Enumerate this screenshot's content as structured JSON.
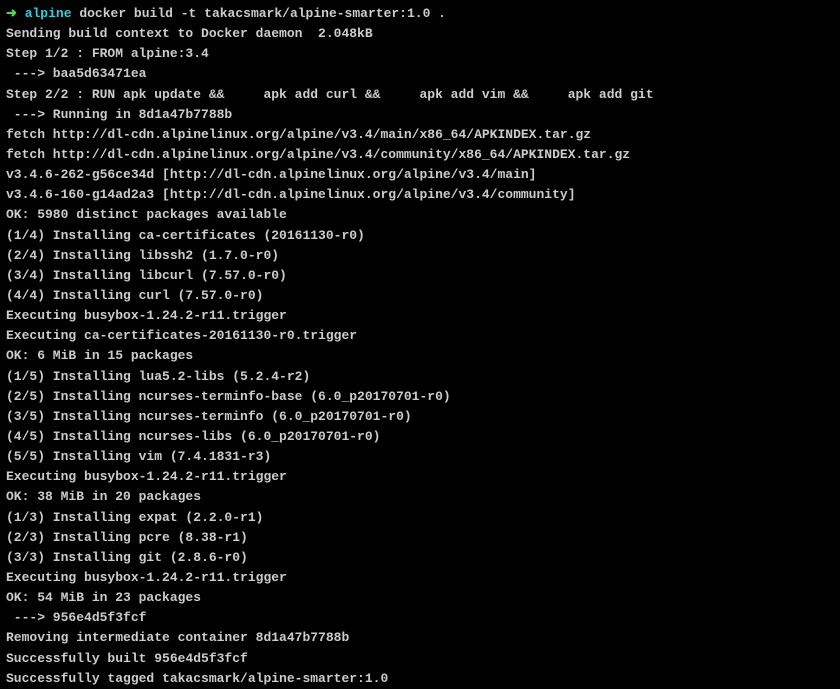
{
  "prompt": {
    "arrow": "➜ ",
    "dir": "alpine",
    "command": " docker build -t takacsmark/alpine-smarter:1.0 ."
  },
  "lines": [
    "Sending build context to Docker daemon  2.048kB",
    "Step 1/2 : FROM alpine:3.4",
    " ---> baa5d63471ea",
    "Step 2/2 : RUN apk update &&     apk add curl &&     apk add vim &&     apk add git",
    " ---> Running in 8d1a47b7788b",
    "fetch http://dl-cdn.alpinelinux.org/alpine/v3.4/main/x86_64/APKINDEX.tar.gz",
    "fetch http://dl-cdn.alpinelinux.org/alpine/v3.4/community/x86_64/APKINDEX.tar.gz",
    "v3.4.6-262-g56ce34d [http://dl-cdn.alpinelinux.org/alpine/v3.4/main]",
    "v3.4.6-160-g14ad2a3 [http://dl-cdn.alpinelinux.org/alpine/v3.4/community]",
    "OK: 5980 distinct packages available",
    "(1/4) Installing ca-certificates (20161130-r0)",
    "(2/4) Installing libssh2 (1.7.0-r0)",
    "(3/4) Installing libcurl (7.57.0-r0)",
    "(4/4) Installing curl (7.57.0-r0)",
    "Executing busybox-1.24.2-r11.trigger",
    "Executing ca-certificates-20161130-r0.trigger",
    "OK: 6 MiB in 15 packages",
    "(1/5) Installing lua5.2-libs (5.2.4-r2)",
    "(2/5) Installing ncurses-terminfo-base (6.0_p20170701-r0)",
    "(3/5) Installing ncurses-terminfo (6.0_p20170701-r0)",
    "(4/5) Installing ncurses-libs (6.0_p20170701-r0)",
    "(5/5) Installing vim (7.4.1831-r3)",
    "Executing busybox-1.24.2-r11.trigger",
    "OK: 38 MiB in 20 packages",
    "(1/3) Installing expat (2.2.0-r1)",
    "(2/3) Installing pcre (8.38-r1)",
    "(3/3) Installing git (2.8.6-r0)",
    "Executing busybox-1.24.2-r11.trigger",
    "OK: 54 MiB in 23 packages",
    " ---> 956e4d5f3fcf",
    "Removing intermediate container 8d1a47b7788b",
    "Successfully built 956e4d5f3fcf",
    "Successfully tagged takacsmark/alpine-smarter:1.0"
  ]
}
